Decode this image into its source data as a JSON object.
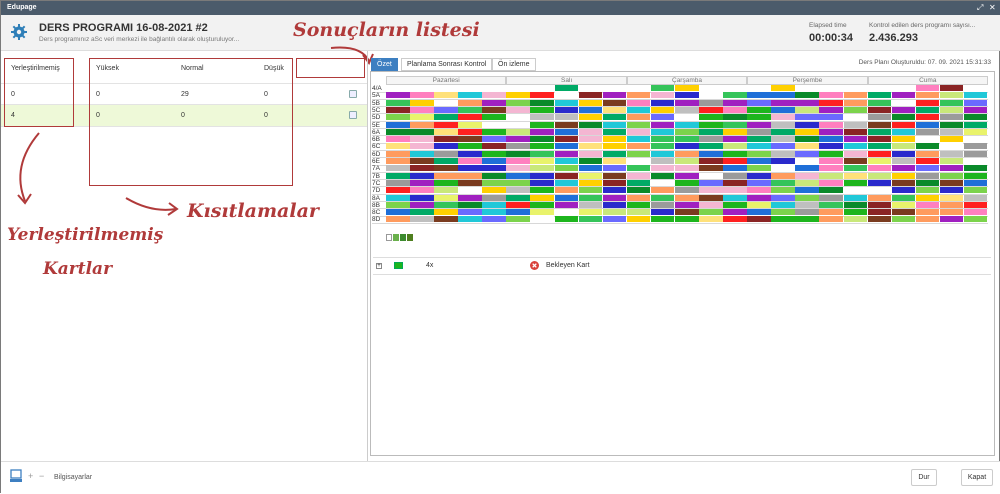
{
  "window": {
    "title": "Edupage"
  },
  "header": {
    "title": "DERS PROGRAMI 16-08-2021 #2",
    "subtitle": "Ders programınız aSc veri merkezi ile bağlantılı olarak oluşturuluyor...",
    "elapsed_label": "Elapsed time",
    "elapsed_value": "00:00:34",
    "checked_label": "Kontrol edilen ders programı sayısı...",
    "checked_value": "2.436.293"
  },
  "annotations": {
    "results": "Sonuçların listesi",
    "unplaced": "Yerleştirilmemiş",
    "cards": "Kartlar",
    "constraints": "Kısıtlamalar"
  },
  "results_table": {
    "headers": {
      "unplaced": "Yerleştirilmemiş",
      "high": "Yüksek",
      "normal": "Normal",
      "low": "Düşük"
    },
    "rows": [
      {
        "unplaced": "0",
        "high": "0",
        "normal": "29",
        "low": "0"
      },
      {
        "unplaced": "4",
        "high": "0",
        "normal": "0",
        "low": "0"
      }
    ]
  },
  "tabs": [
    "Özet",
    "Planlama Sonrası Kontrol",
    "Ön izleme"
  ],
  "plan_info": "Ders Planı Oluşturuldu: 07. 09. 2021 15:31:33",
  "days": [
    "Pazartesi",
    "Salı",
    "Çarşamba",
    "Perşembe",
    "Cuma"
  ],
  "classes": [
    "4/A",
    "5A",
    "5B",
    "5C",
    "5D",
    "5E",
    "6A",
    "6B",
    "6C",
    "6D",
    "6E",
    "7A",
    "7B",
    "7C",
    "7D",
    "8A",
    "8B",
    "8C",
    "8D"
  ],
  "pending": {
    "count": "4x",
    "label": "Bekleyen Kart"
  },
  "footer": {
    "computers": "Bilgisayarlar",
    "stop": "Dur",
    "close": "Kapat"
  },
  "colors": {
    "titlebar": "#4b5b6b",
    "accent": "#3d7fc1",
    "annotation": "#b03a3a",
    "highlight": "#eef9d8"
  },
  "icons": {
    "settings": "gear-icon",
    "save": "save-icon",
    "error": "error-icon",
    "expand": "expand-icon",
    "close": "close-icon"
  }
}
